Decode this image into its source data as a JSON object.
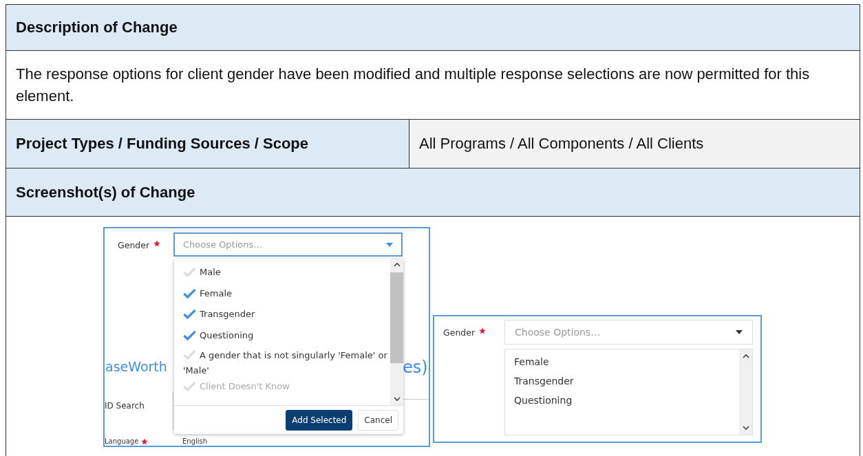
{
  "description_header": "Description of Change",
  "description": "The response options for client gender have been modified and multiple response selections are now permitted for this element.",
  "scope": {
    "label": "Project Types / Funding Sources / Scope",
    "value": "All Programs / All Components / All Clients"
  },
  "screenshots_header": "Screenshot(s) of Change",
  "screenshot_open": {
    "field_label": "Gender",
    "required": true,
    "placeholder": "Choose Options…",
    "background": {
      "title_left": "aseWorth",
      "title_right": "es)",
      "id_search_label": "ID Search",
      "language_label": "Language",
      "language_value": "English"
    },
    "options": [
      {
        "label": "Male",
        "checked": false
      },
      {
        "label": "Female",
        "checked": true
      },
      {
        "label": "Transgender",
        "checked": true
      },
      {
        "label": "Questioning",
        "checked": true
      },
      {
        "label": "A gender that is not singularly 'Female' or 'Male'",
        "checked": false
      },
      {
        "label": "Client Doesn't Know",
        "checked": false
      }
    ],
    "buttons": [
      {
        "label": "Add Selected",
        "kind": "primary"
      },
      {
        "label": "Cancel",
        "kind": "secondary"
      }
    ]
  },
  "screenshot_selected": {
    "field_label": "Gender",
    "required": true,
    "placeholder": "Choose Options…",
    "selected_options": [
      "Female",
      "Transgender",
      "Questioning"
    ]
  }
}
